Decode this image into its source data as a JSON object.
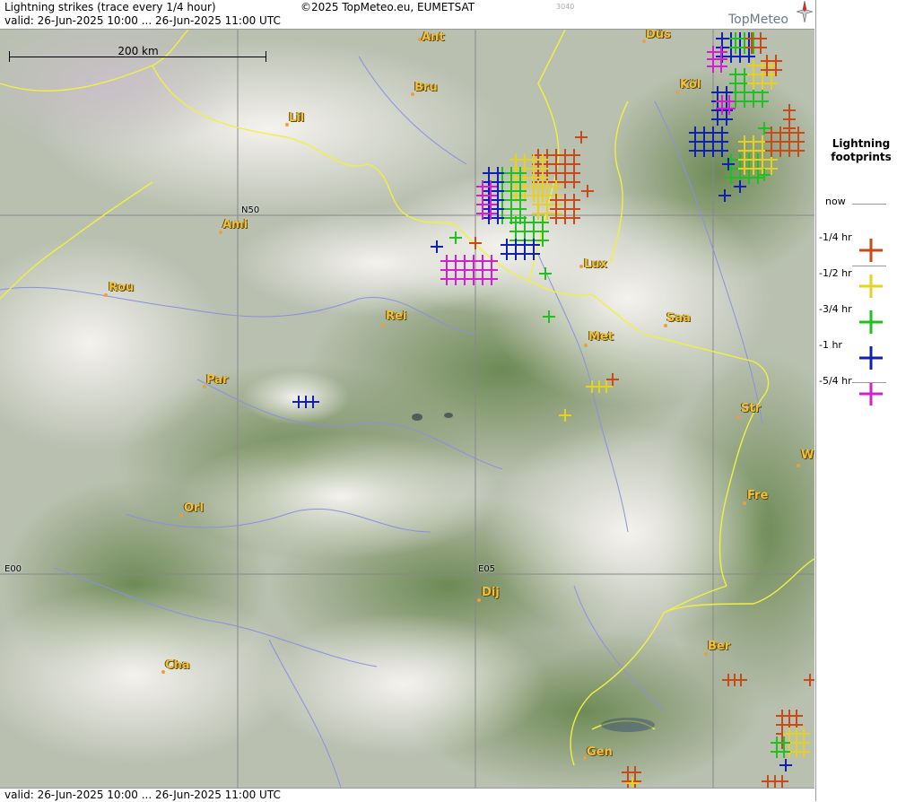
{
  "header": {
    "title": "Lightning strikes (trace every 1/4 hour)",
    "valid": "valid:  26-Jun-2025 10:00 ... 26-Jun-2025 11:00 UTC",
    "copyright": "©2025 TopMeteo.eu, EUMETSAT",
    "code": "3040",
    "logo": "TopMeteo"
  },
  "footer": {
    "valid": "valid:  26-Jun-2025 10:00 ... 26-Jun-2025 11:00 UTC"
  },
  "scale": {
    "label": "200 km"
  },
  "grid": {
    "n50": "N50",
    "e00": "E00",
    "e05": "E05"
  },
  "cities": [
    {
      "name": "Ant"
    },
    {
      "name": "Düs"
    },
    {
      "name": "Bru"
    },
    {
      "name": "Köl"
    },
    {
      "name": "Lil"
    },
    {
      "name": "Ami"
    },
    {
      "name": "Lux"
    },
    {
      "name": "Rou"
    },
    {
      "name": "Rei"
    },
    {
      "name": "Saa"
    },
    {
      "name": "Met"
    },
    {
      "name": "Par"
    },
    {
      "name": "Str"
    },
    {
      "name": "W"
    },
    {
      "name": "Fre"
    },
    {
      "name": "Orl"
    },
    {
      "name": "Dij"
    },
    {
      "name": "Ber"
    },
    {
      "name": "Cha"
    },
    {
      "name": "Gen"
    }
  ],
  "legend": {
    "title_line1": "Lightning",
    "title_line2": "footprints",
    "rows": [
      {
        "label": "now",
        "color": ""
      },
      {
        "label": "-1/4 hr",
        "color": "#c84a18"
      },
      {
        "label": "-1/2 hr",
        "color": "#e6d020"
      },
      {
        "label": "-3/4 hr",
        "color": "#20c020"
      },
      {
        "label": "-1 hr",
        "color": "#1020b0"
      },
      {
        "label": "-5/4 hr",
        "color": "#d020d0"
      }
    ]
  },
  "colors": {
    "border": "#f0f040",
    "river": "#8a90e0",
    "q1": "#c84a18",
    "q2": "#e6d020",
    "q3": "#20c020",
    "q4": "#1020b0",
    "q5": "#d020d0"
  }
}
